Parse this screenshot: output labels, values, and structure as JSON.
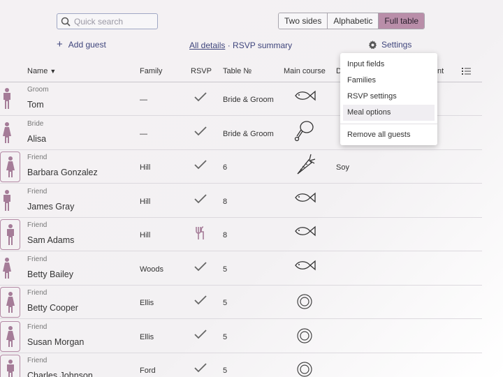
{
  "search": {
    "placeholder": "Quick search"
  },
  "view_toggle": [
    "Two sides",
    "Alphabetic",
    "Full table"
  ],
  "view_toggle_selected": "Full table",
  "add_guest_label": "Add guest",
  "links": {
    "all_details": "All details",
    "separator": "·",
    "rsvp_summary": "RSVP summary"
  },
  "settings_label": "Settings",
  "columns": {
    "name": "Name",
    "family": "Family",
    "rsvp": "RSVP",
    "table": "Table №",
    "main_course": "Main course",
    "diet_partial": "D",
    "comment_partial": "nt"
  },
  "dropdown": {
    "items": [
      "Input fields",
      "Families",
      "RSVP settings",
      "Meal options"
    ],
    "remove": "Remove all guests"
  },
  "guests": [
    {
      "role": "Groom",
      "name": "Tom",
      "family": "—",
      "rsvp": "yes",
      "table": "Bride & Groom",
      "meal": "fish",
      "diet": "",
      "gender": "male",
      "framed": false
    },
    {
      "role": "Bride",
      "name": "Alisa",
      "family": "—",
      "rsvp": "yes",
      "table": "Bride & Groom",
      "meal": "meat",
      "diet": "",
      "gender": "female",
      "framed": false
    },
    {
      "role": "Friend",
      "name": "Barbara Gonzalez",
      "family": "Hill",
      "rsvp": "yes",
      "table": "6",
      "meal": "carrot",
      "diet": "Soy",
      "gender": "female",
      "framed": true
    },
    {
      "role": "Friend",
      "name": "James Gray",
      "family": "Hill",
      "rsvp": "yes",
      "table": "8",
      "meal": "fish",
      "diet": "",
      "gender": "male",
      "framed": false
    },
    {
      "role": "Friend",
      "name": "Sam Adams",
      "family": "Hill",
      "rsvp": "cutlery",
      "table": "8",
      "meal": "fish",
      "diet": "",
      "gender": "male",
      "framed": true
    },
    {
      "role": "Friend",
      "name": "Betty Bailey",
      "family": "Woods",
      "rsvp": "yes",
      "table": "5",
      "meal": "fish",
      "diet": "",
      "gender": "female",
      "framed": false
    },
    {
      "role": "Friend",
      "name": "Betty Cooper",
      "family": "Ellis",
      "rsvp": "yes",
      "table": "5",
      "meal": "plate",
      "diet": "",
      "gender": "female",
      "framed": true
    },
    {
      "role": "Friend",
      "name": "Susan Morgan",
      "family": "Ellis",
      "rsvp": "yes",
      "table": "5",
      "meal": "plate",
      "diet": "",
      "gender": "female",
      "framed": true
    },
    {
      "role": "Friend",
      "name": "Charles Johnson",
      "family": "Ford",
      "rsvp": "yes",
      "table": "5",
      "meal": "plate",
      "diet": "",
      "gender": "male",
      "framed": true
    }
  ],
  "colors": {
    "accent": "#b98ea9",
    "link": "#3f457c",
    "person": "#a57c98"
  }
}
